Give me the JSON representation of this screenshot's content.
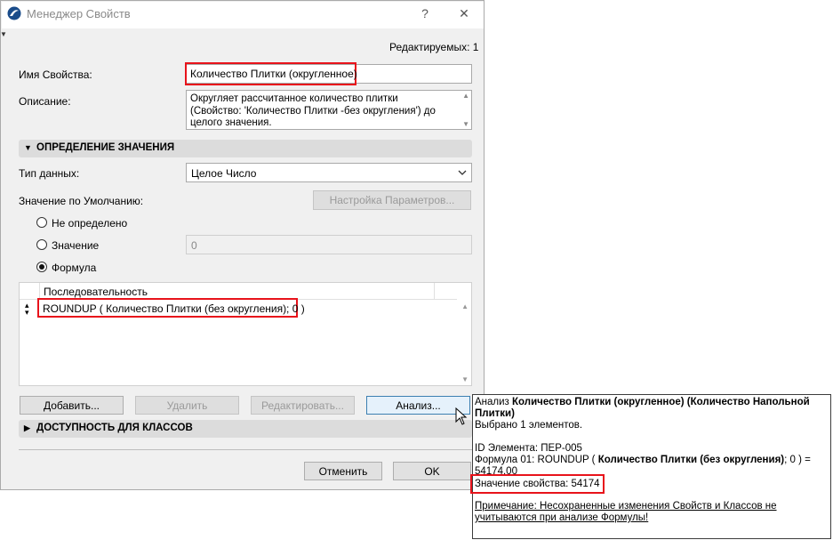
{
  "window": {
    "title": "Менеджер Свойств",
    "help": "?",
    "close": "✕"
  },
  "editable_count": "Редактируемых: 1",
  "fields": {
    "name_label": "Имя Свойства:",
    "name_value": "Количество Плитки (округленное)",
    "desc_label": "Описание:",
    "desc_line1": "Округляет рассчитанное количество плитки",
    "desc_line2": "(Свойство: 'Количество Плитки -без округления') до",
    "desc_line3": "целого значения."
  },
  "value_section": {
    "title": "ОПРЕДЕЛЕНИЕ ЗНАЧЕНИЯ",
    "data_type_label": "Тип данных:",
    "data_type_value": "Целое Число",
    "default_label": "Значение по Умолчанию:",
    "params_button": "Настройка Параметров...",
    "radio_undefined": "Не определено",
    "radio_value": "Значение",
    "value_input": "0",
    "radio_formula": "Формула",
    "selected": "Формула"
  },
  "sequence": {
    "header": "Последовательность",
    "row": "ROUNDUP ( Количество Плитки (без округления); 0 )"
  },
  "buttons": {
    "add": "Добавить...",
    "delete": "Удалить",
    "edit": "Редактировать...",
    "analyze": "Анализ...",
    "cancel": "Отменить",
    "ok": "OK"
  },
  "classes_section": {
    "title": "ДОСТУПНОСТЬ ДЛЯ КЛАССОВ"
  },
  "analysis_popup": {
    "prefix": "Анализ ",
    "bold_title_1": "Количество Плитки (округленное) (Количество Напольной",
    "bold_title_2": "Плитки)",
    "selected": "Выбрано 1 элементов.",
    "element_id": "ID Элемента: ПЕР-005",
    "formula_prefix": "Формула 01: ROUNDUP ( ",
    "formula_bold": "Количество Плитки (без округления)",
    "formula_suffix": "; 0 ) =",
    "formula_result": "54174.00",
    "property_value": "Значение свойства: 54174",
    "note_1": "Примечание: Несохраненные изменения Свойств и Классов не",
    "note_2": "учитываются при анализе Формулы!"
  },
  "colors": {
    "highlight": "#e8131b",
    "dialog_bg": "#f0f0f0"
  }
}
